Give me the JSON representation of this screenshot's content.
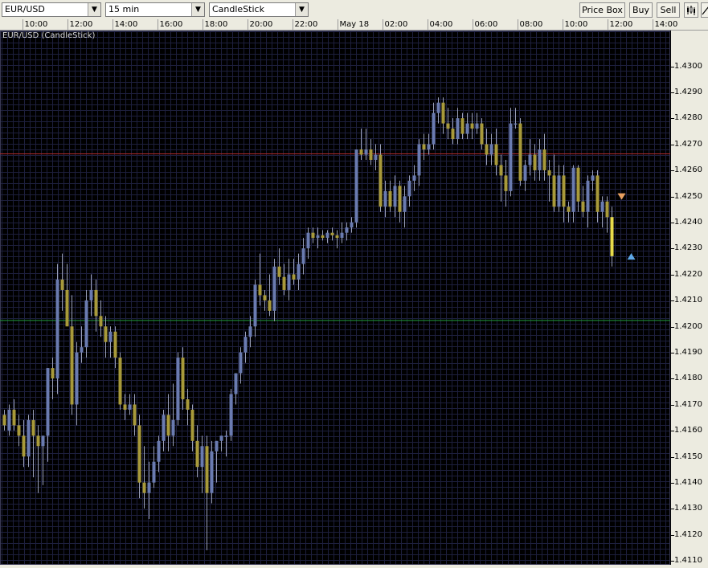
{
  "toolbar": {
    "symbol": "EUR/USD",
    "interval": "15 min",
    "chart_type": "CandleStick",
    "price_box_label": "Price Box",
    "buy_label": "Buy",
    "sell_label": "Sell"
  },
  "time_axis": [
    "10:00",
    "12:00",
    "14:00",
    "16:00",
    "18:00",
    "20:00",
    "22:00",
    "May 18",
    "02:00",
    "04:00",
    "06:00",
    "08:00",
    "10:00",
    "12:00",
    "14:00"
  ],
  "price_axis": [
    "1.4300",
    "1.4290",
    "1.4280",
    "1.4270",
    "1.4260",
    "1.4250",
    "1.4240",
    "1.4230",
    "1.4220",
    "1.4210",
    "1.4200",
    "1.4190",
    "1.4180",
    "1.4170",
    "1.4160",
    "1.4150",
    "1.4140",
    "1.4130",
    "1.4120",
    "1.4110"
  ],
  "colors": {
    "background": "#000000",
    "grid": "#1d1f3d",
    "up_candle": "#6a7bb0",
    "down_candle": "#a89a3a",
    "resistance_line": "#b02a2a",
    "support_line": "#1f9a3a",
    "sell_marker": "#e8a060",
    "buy_marker": "#5fa8e8"
  },
  "chart_data": {
    "type": "candlestick",
    "title": "EUR/USD (CandleStick)",
    "y_range": [
      1.41085,
      1.43138
    ],
    "horizontal_lines": [
      {
        "name": "resistance",
        "value": 1.42664
      },
      {
        "name": "support",
        "value": 1.42024
      }
    ],
    "markers": [
      {
        "type": "sell",
        "index": 128,
        "value": 1.425
      },
      {
        "type": "buy",
        "index": 130,
        "value": 1.4227
      }
    ],
    "candles": [
      [
        1.41661,
        1.41681,
        1.41601,
        1.41621
      ],
      [
        1.41601,
        1.41701,
        1.41581,
        1.41681
      ],
      [
        1.41681,
        1.41721,
        1.41601,
        1.41621
      ],
      [
        1.41621,
        1.41661,
        1.41541,
        1.41581
      ],
      [
        1.41581,
        1.41641,
        1.41461,
        1.41501
      ],
      [
        1.41501,
        1.41661,
        1.41461,
        1.41641
      ],
      [
        1.41641,
        1.41681,
        1.41421,
        1.41581
      ],
      [
        1.41581,
        1.41621,
        1.41361,
        1.41541
      ],
      [
        1.41541,
        1.41581,
        1.41391,
        1.41581
      ],
      [
        1.41581,
        1.41841,
        1.41481,
        1.41841
      ],
      [
        1.41841,
        1.41881,
        1.41721,
        1.41801
      ],
      [
        1.41801,
        1.42241,
        1.41741,
        1.42181
      ],
      [
        1.42181,
        1.42281,
        1.42061,
        1.42141
      ],
      [
        1.42141,
        1.42241,
        1.42021,
        1.42001
      ],
      [
        1.42001,
        1.42121,
        1.41661,
        1.41701
      ],
      [
        1.41701,
        1.41941,
        1.41621,
        1.41901
      ],
      [
        1.41901,
        1.42001,
        1.41861,
        1.41921
      ],
      [
        1.41921,
        1.42141,
        1.41881,
        1.42101
      ],
      [
        1.42101,
        1.42201,
        1.42041,
        1.42141
      ],
      [
        1.42141,
        1.42181,
        1.41981,
        1.42041
      ],
      [
        1.42041,
        1.42101,
        1.41961,
        1.42001
      ],
      [
        1.42001,
        1.42041,
        1.41881,
        1.41941
      ],
      [
        1.41941,
        1.42001,
        1.41881,
        1.41981
      ],
      [
        1.41981,
        1.42001,
        1.41841,
        1.41881
      ],
      [
        1.41881,
        1.41901,
        1.41681,
        1.41701
      ],
      [
        1.41701,
        1.41741,
        1.41641,
        1.41681
      ],
      [
        1.41681,
        1.41741,
        1.41661,
        1.41701
      ],
      [
        1.41701,
        1.41741,
        1.41581,
        1.41621
      ],
      [
        1.41621,
        1.41661,
        1.41341,
        1.41401
      ],
      [
        1.41401,
        1.41541,
        1.41301,
        1.41361
      ],
      [
        1.41361,
        1.41481,
        1.41261,
        1.41401
      ],
      [
        1.41401,
        1.41541,
        1.41381,
        1.41481
      ],
      [
        1.41481,
        1.41581,
        1.41441,
        1.41561
      ],
      [
        1.41561,
        1.41681,
        1.41521,
        1.41661
      ],
      [
        1.41661,
        1.41741,
        1.41521,
        1.41581
      ],
      [
        1.41581,
        1.41781,
        1.41541,
        1.41641
      ],
      [
        1.41641,
        1.41901,
        1.41621,
        1.41881
      ],
      [
        1.41881,
        1.41921,
        1.41681,
        1.41721
      ],
      [
        1.41721,
        1.41761,
        1.41621,
        1.41681
      ],
      [
        1.41681,
        1.41701,
        1.41521,
        1.41561
      ],
      [
        1.41561,
        1.41621,
        1.41421,
        1.41461
      ],
      [
        1.41461,
        1.41581,
        1.41361,
        1.41541
      ],
      [
        1.41541,
        1.41581,
        1.41141,
        1.41361
      ],
      [
        1.41361,
        1.41561,
        1.41321,
        1.41521
      ],
      [
        1.41521,
        1.41561,
        1.41401,
        1.41561
      ],
      [
        1.41561,
        1.41581,
        1.41521,
        1.41581
      ],
      [
        1.41581,
        1.41601,
        1.41501,
        1.41581
      ],
      [
        1.41581,
        1.41761,
        1.41561,
        1.41741
      ],
      [
        1.41741,
        1.41821,
        1.41701,
        1.41821
      ],
      [
        1.41821,
        1.41921,
        1.41781,
        1.41901
      ],
      [
        1.41901,
        1.41981,
        1.41861,
        1.41961
      ],
      [
        1.41961,
        1.42041,
        1.41921,
        1.42001
      ],
      [
        1.42001,
        1.42181,
        1.41961,
        1.42161
      ],
      [
        1.42161,
        1.42281,
        1.42081,
        1.42121
      ],
      [
        1.42121,
        1.42141,
        1.42061,
        1.42101
      ],
      [
        1.42101,
        1.42201,
        1.42041,
        1.42061
      ],
      [
        1.42061,
        1.42261,
        1.42021,
        1.42231
      ],
      [
        1.42231,
        1.42301,
        1.42161,
        1.42191
      ],
      [
        1.42191,
        1.42241,
        1.42121,
        1.42141
      ],
      [
        1.42141,
        1.42261,
        1.42101,
        1.42201
      ],
      [
        1.42201,
        1.42261,
        1.42161,
        1.42181
      ],
      [
        1.42181,
        1.42281,
        1.42141,
        1.42241
      ],
      [
        1.42241,
        1.42341,
        1.42201,
        1.42301
      ],
      [
        1.42301,
        1.42381,
        1.42261,
        1.42361
      ],
      [
        1.42361,
        1.42381,
        1.42321,
        1.42341
      ],
      [
        1.42341,
        1.42381,
        1.42301,
        1.42351
      ],
      [
        1.42351,
        1.42371,
        1.42331,
        1.42341
      ],
      [
        1.42341,
        1.42371,
        1.42321,
        1.42361
      ],
      [
        1.42361,
        1.42381,
        1.42331,
        1.42351
      ],
      [
        1.42351,
        1.42371,
        1.42301,
        1.42341
      ],
      [
        1.42341,
        1.42401,
        1.42321,
        1.42361
      ],
      [
        1.42361,
        1.42401,
        1.42331,
        1.42381
      ],
      [
        1.42381,
        1.42421,
        1.42361,
        1.42401
      ],
      [
        1.42401,
        1.42681,
        1.42381,
        1.42681
      ],
      [
        1.42681,
        1.42761,
        1.42641,
        1.42661
      ],
      [
        1.42661,
        1.42761,
        1.42641,
        1.42681
      ],
      [
        1.42681,
        1.42721,
        1.42621,
        1.42641
      ],
      [
        1.42641,
        1.42701,
        1.42601,
        1.42661
      ],
      [
        1.42661,
        1.42701,
        1.42441,
        1.42461
      ],
      [
        1.42461,
        1.42561,
        1.42421,
        1.42521
      ],
      [
        1.42521,
        1.42561,
        1.42441,
        1.42461
      ],
      [
        1.42461,
        1.42581,
        1.42421,
        1.42541
      ],
      [
        1.42541,
        1.42561,
        1.42401,
        1.42441
      ],
      [
        1.42441,
        1.42541,
        1.42381,
        1.42501
      ],
      [
        1.42501,
        1.42581,
        1.42461,
        1.42561
      ],
      [
        1.42561,
        1.42621,
        1.42521,
        1.42581
      ],
      [
        1.42581,
        1.42721,
        1.42541,
        1.42701
      ],
      [
        1.42701,
        1.42741,
        1.42641,
        1.42681
      ],
      [
        1.42681,
        1.42741,
        1.42661,
        1.42701
      ],
      [
        1.42701,
        1.42861,
        1.42681,
        1.42821
      ],
      [
        1.42821,
        1.42881,
        1.42781,
        1.42861
      ],
      [
        1.42861,
        1.42881,
        1.42741,
        1.42781
      ],
      [
        1.42781,
        1.42841,
        1.42721,
        1.42761
      ],
      [
        1.42761,
        1.42801,
        1.42701,
        1.42721
      ],
      [
        1.42721,
        1.42841,
        1.42701,
        1.42801
      ],
      [
        1.42801,
        1.42821,
        1.42721,
        1.42741
      ],
      [
        1.42741,
        1.42821,
        1.42721,
        1.42781
      ],
      [
        1.42781,
        1.42821,
        1.42721,
        1.42761
      ],
      [
        1.42761,
        1.42821,
        1.42741,
        1.42781
      ],
      [
        1.42781,
        1.42801,
        1.42681,
        1.42701
      ],
      [
        1.42701,
        1.42761,
        1.42621,
        1.42661
      ],
      [
        1.42661,
        1.42741,
        1.42621,
        1.42701
      ],
      [
        1.42701,
        1.42761,
        1.42581,
        1.42621
      ],
      [
        1.42621,
        1.42661,
        1.42481,
        1.42581
      ],
      [
        1.42581,
        1.42641,
        1.42461,
        1.42521
      ],
      [
        1.42521,
        1.42841,
        1.42501,
        1.42781
      ],
      [
        1.42781,
        1.42841,
        1.42761,
        1.42781
      ],
      [
        1.42781,
        1.42801,
        1.42541,
        1.42561
      ],
      [
        1.42561,
        1.42641,
        1.42521,
        1.42621
      ],
      [
        1.42621,
        1.42721,
        1.42581,
        1.42661
      ],
      [
        1.42661,
        1.42701,
        1.42561,
        1.42601
      ],
      [
        1.42601,
        1.42721,
        1.42561,
        1.42681
      ],
      [
        1.42681,
        1.42741,
        1.42561,
        1.42601
      ],
      [
        1.42601,
        1.42641,
        1.42481,
        1.42581
      ],
      [
        1.42581,
        1.42661,
        1.42441,
        1.42461
      ],
      [
        1.42461,
        1.42621,
        1.42441,
        1.42581
      ],
      [
        1.42581,
        1.42621,
        1.42401,
        1.42461
      ],
      [
        1.42461,
        1.42481,
        1.42401,
        1.42441
      ],
      [
        1.42441,
        1.42621,
        1.42401,
        1.42611
      ],
      [
        1.42611,
        1.42621,
        1.42441,
        1.42481
      ],
      [
        1.42481,
        1.42541,
        1.42421,
        1.42441
      ],
      [
        1.42441,
        1.42581,
        1.42381,
        1.42561
      ],
      [
        1.42561,
        1.42601,
        1.42521,
        1.42581
      ],
      [
        1.42581,
        1.42601,
        1.42401,
        1.42441
      ],
      [
        1.42441,
        1.42501,
        1.42381,
        1.42481
      ],
      [
        1.42481,
        1.42501,
        1.42361,
        1.42421
      ],
      [
        1.42421,
        1.42461,
        1.42231,
        1.42271
      ]
    ]
  }
}
